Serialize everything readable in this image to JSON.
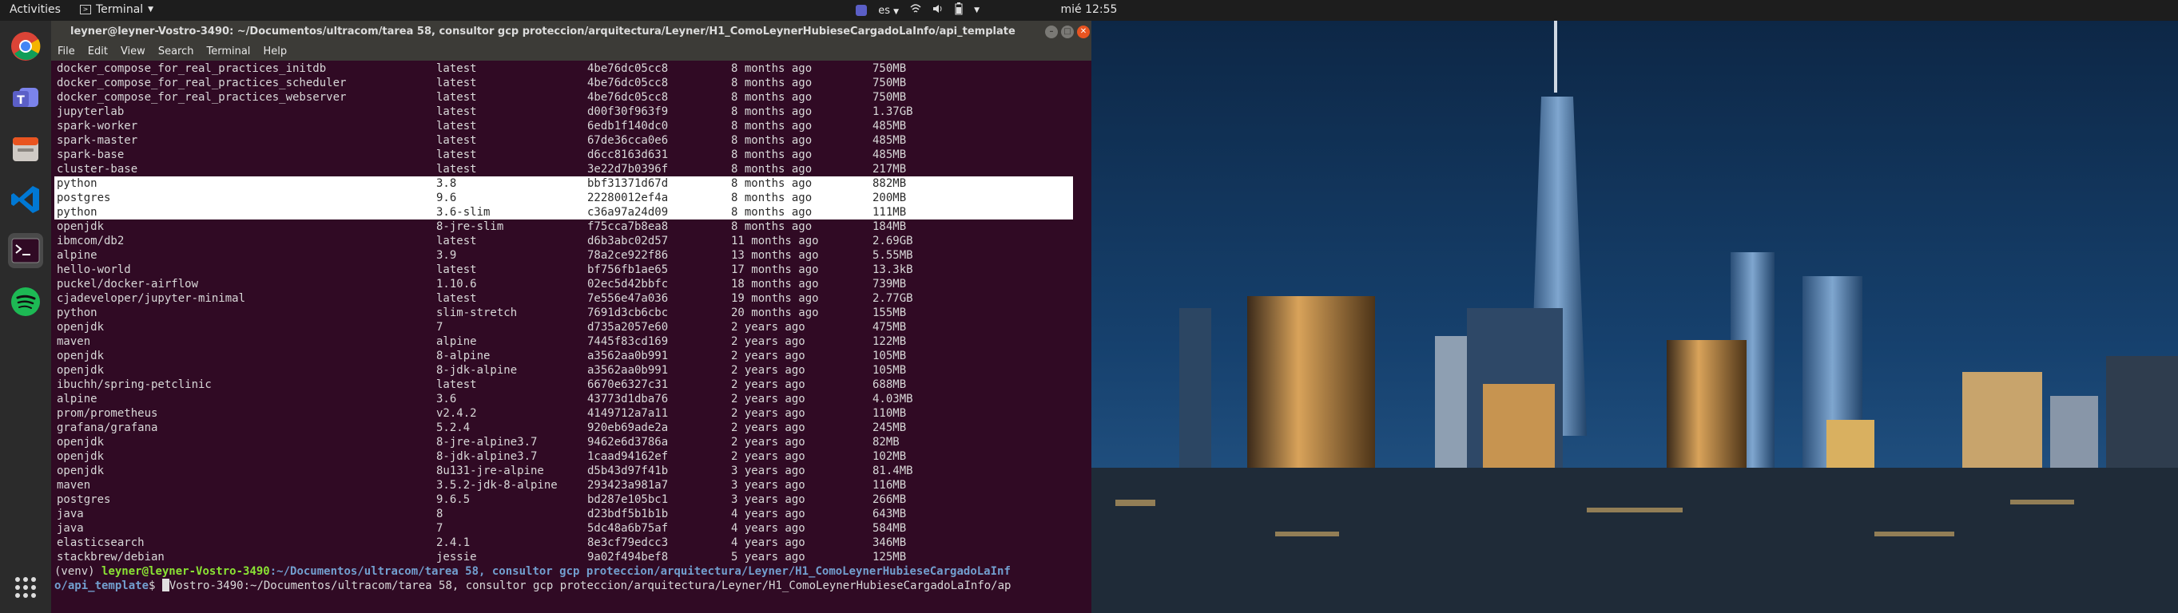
{
  "topbar": {
    "activities": "Activities",
    "app_name": "Terminal",
    "clock": "mié 12:55",
    "keyboard_layout": "es"
  },
  "dock": {
    "items": [
      {
        "name": "Google Chrome",
        "icon": "chrome-icon"
      },
      {
        "name": "Microsoft Teams",
        "icon": "teams-icon"
      },
      {
        "name": "Files",
        "icon": "files-icon"
      },
      {
        "name": "Visual Studio Code",
        "icon": "vscode-icon"
      },
      {
        "name": "Terminal",
        "icon": "terminal-icon"
      },
      {
        "name": "Spotify",
        "icon": "spotify-icon"
      }
    ],
    "show_apps": "grid-icon"
  },
  "window": {
    "title": "leyner@leyner-Vostro-3490: ~/Documentos/ultracom/tarea 58, consultor gcp proteccion/arquitectura/Leyner/H1_ComoLeynerHubieseCargadoLaInfo/api_template",
    "menu": [
      "File",
      "Edit",
      "View",
      "Search",
      "Terminal",
      "Help"
    ]
  },
  "terminal": {
    "rows": [
      {
        "repo": "docker_compose_for_real_practices_initdb",
        "tag": "latest",
        "id": "4be76dc05cc8",
        "created": "8 months ago",
        "size": "750MB",
        "selected": false
      },
      {
        "repo": "docker_compose_for_real_practices_scheduler",
        "tag": "latest",
        "id": "4be76dc05cc8",
        "created": "8 months ago",
        "size": "750MB",
        "selected": false
      },
      {
        "repo": "docker_compose_for_real_practices_webserver",
        "tag": "latest",
        "id": "4be76dc05cc8",
        "created": "8 months ago",
        "size": "750MB",
        "selected": false
      },
      {
        "repo": "jupyterlab",
        "tag": "latest",
        "id": "d00f30f963f9",
        "created": "8 months ago",
        "size": "1.37GB",
        "selected": false
      },
      {
        "repo": "spark-worker",
        "tag": "latest",
        "id": "6edb1f140dc0",
        "created": "8 months ago",
        "size": "485MB",
        "selected": false
      },
      {
        "repo": "spark-master",
        "tag": "latest",
        "id": "67de36cca0e6",
        "created": "8 months ago",
        "size": "485MB",
        "selected": false
      },
      {
        "repo": "spark-base",
        "tag": "latest",
        "id": "d6cc8163d631",
        "created": "8 months ago",
        "size": "485MB",
        "selected": false
      },
      {
        "repo": "cluster-base",
        "tag": "latest",
        "id": "3e22d7b0396f",
        "created": "8 months ago",
        "size": "217MB",
        "selected": false
      },
      {
        "repo": "python",
        "tag": "3.8",
        "id": "bbf31371d67d",
        "created": "8 months ago",
        "size": "882MB",
        "selected": true
      },
      {
        "repo": "postgres",
        "tag": "9.6",
        "id": "22280012ef4a",
        "created": "8 months ago",
        "size": "200MB",
        "selected": true
      },
      {
        "repo": "python",
        "tag": "3.6-slim",
        "id": "c36a97a24d09",
        "created": "8 months ago",
        "size": "111MB",
        "selected": true
      },
      {
        "repo": "openjdk",
        "tag": "8-jre-slim",
        "id": "f75cca7b8ea8",
        "created": "8 months ago",
        "size": "184MB",
        "selected": false
      },
      {
        "repo": "ibmcom/db2",
        "tag": "latest",
        "id": "d6b3abc02d57",
        "created": "11 months ago",
        "size": "2.69GB",
        "selected": false
      },
      {
        "repo": "alpine",
        "tag": "3.9",
        "id": "78a2ce922f86",
        "created": "13 months ago",
        "size": "5.55MB",
        "selected": false
      },
      {
        "repo": "hello-world",
        "tag": "latest",
        "id": "bf756fb1ae65",
        "created": "17 months ago",
        "size": "13.3kB",
        "selected": false
      },
      {
        "repo": "puckel/docker-airflow",
        "tag": "1.10.6",
        "id": "02ec5d42bbfc",
        "created": "18 months ago",
        "size": "739MB",
        "selected": false
      },
      {
        "repo": "cjadeveloper/jupyter-minimal",
        "tag": "latest",
        "id": "7e556e47a036",
        "created": "19 months ago",
        "size": "2.77GB",
        "selected": false
      },
      {
        "repo": "python",
        "tag": "slim-stretch",
        "id": "7691d3cb6cbc",
        "created": "20 months ago",
        "size": "155MB",
        "selected": false
      },
      {
        "repo": "openjdk",
        "tag": "7",
        "id": "d735a2057e60",
        "created": "2 years ago",
        "size": "475MB",
        "selected": false
      },
      {
        "repo": "maven",
        "tag": "alpine",
        "id": "7445f83cd169",
        "created": "2 years ago",
        "size": "122MB",
        "selected": false
      },
      {
        "repo": "openjdk",
        "tag": "8-alpine",
        "id": "a3562aa0b991",
        "created": "2 years ago",
        "size": "105MB",
        "selected": false
      },
      {
        "repo": "openjdk",
        "tag": "8-jdk-alpine",
        "id": "a3562aa0b991",
        "created": "2 years ago",
        "size": "105MB",
        "selected": false
      },
      {
        "repo": "ibuchh/spring-petclinic",
        "tag": "latest",
        "id": "6670e6327c31",
        "created": "2 years ago",
        "size": "688MB",
        "selected": false
      },
      {
        "repo": "alpine",
        "tag": "3.6",
        "id": "43773d1dba76",
        "created": "2 years ago",
        "size": "4.03MB",
        "selected": false
      },
      {
        "repo": "prom/prometheus",
        "tag": "v2.4.2",
        "id": "4149712a7a11",
        "created": "2 years ago",
        "size": "110MB",
        "selected": false
      },
      {
        "repo": "grafana/grafana",
        "tag": "5.2.4",
        "id": "920eb69ade2a",
        "created": "2 years ago",
        "size": "245MB",
        "selected": false
      },
      {
        "repo": "openjdk",
        "tag": "8-jre-alpine3.7",
        "id": "9462e6d3786a",
        "created": "2 years ago",
        "size": "82MB",
        "selected": false
      },
      {
        "repo": "openjdk",
        "tag": "8-jdk-alpine3.7",
        "id": "1caad94162ef",
        "created": "2 years ago",
        "size": "102MB",
        "selected": false
      },
      {
        "repo": "openjdk",
        "tag": "8u131-jre-alpine",
        "id": "d5b43d97f41b",
        "created": "3 years ago",
        "size": "81.4MB",
        "selected": false
      },
      {
        "repo": "maven",
        "tag": "3.5.2-jdk-8-alpine",
        "id": "293423a981a7",
        "created": "3 years ago",
        "size": "116MB",
        "selected": false
      },
      {
        "repo": "postgres",
        "tag": "9.6.5",
        "id": "bd287e105bc1",
        "created": "3 years ago",
        "size": "266MB",
        "selected": false
      },
      {
        "repo": "java",
        "tag": "8",
        "id": "d23bdf5b1b1b",
        "created": "4 years ago",
        "size": "643MB",
        "selected": false
      },
      {
        "repo": "java",
        "tag": "7",
        "id": "5dc48a6b75af",
        "created": "4 years ago",
        "size": "584MB",
        "selected": false
      },
      {
        "repo": "elasticsearch",
        "tag": "2.4.1",
        "id": "8e3cf79edcc3",
        "created": "4 years ago",
        "size": "346MB",
        "selected": false
      },
      {
        "repo": "stackbrew/debian",
        "tag": "jessie",
        "id": "9a02f494bef8",
        "created": "5 years ago",
        "size": "125MB",
        "selected": false
      }
    ],
    "prompt": {
      "venv": "(venv) ",
      "user_host": "leyner@leyner-Vostro-3490",
      "path_line1": ":~/Documentos/ultracom/tarea 58, consultor gcp proteccion/arquitectura/Leyner/H1_ComoLeynerHubieseCargadoLaInf",
      "path_line2": "o/api_template",
      "dollar": "$ ",
      "typed_text": "Vostro-3490:~/Documentos/ultracom/tarea 58, consultor gcp proteccion/arquitectura/Leyner/H1_ComoLeynerHubieseCargadoLaInfo/ap"
    }
  },
  "colors": {
    "terminal_bg": "#300a24",
    "prompt_green": "#8ae234",
    "prompt_blue": "#729fcf",
    "selection_bg": "#ffffff"
  }
}
